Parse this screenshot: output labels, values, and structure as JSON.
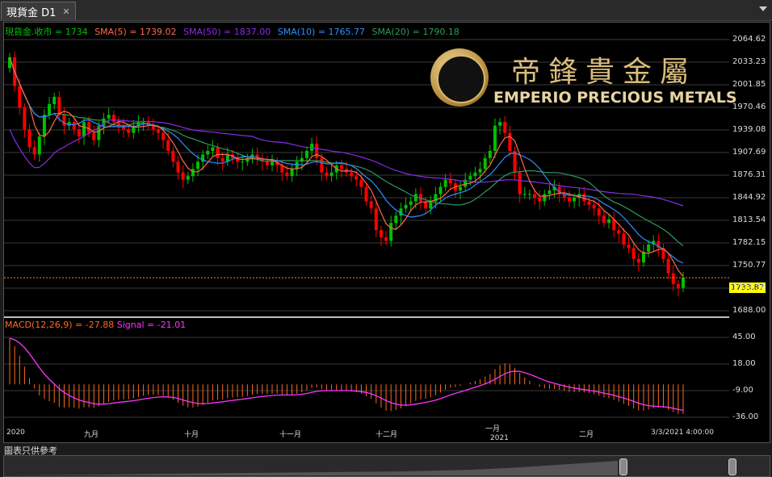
{
  "window": {
    "tab_title": "現貨金 D1",
    "close_label": "✕"
  },
  "legend": {
    "symbol": "現貨金.收市 = 1734",
    "sma5": "SMA(5) = 1739.02",
    "sma50": "SMA(50) = 1837.00",
    "sma10": "SMA(10) = 1765.77",
    "sma20": "SMA(20) = 1790.18"
  },
  "macd_legend": {
    "macd": "MACD(12,26,9) = -27.88",
    "signal": "Signal = -21.01"
  },
  "logo": {
    "chinese": "帝鋒貴金屬",
    "english": "EMPERIO PRECIOUS METALS"
  },
  "price_axis": [
    "2064.62",
    "2033.23",
    "2001.85",
    "1970.46",
    "1939.08",
    "1907.69",
    "1876.31",
    "1844.92",
    "1813.54",
    "1782.15",
    "1750.77",
    "1719.38",
    "1688.00"
  ],
  "current_price": "1733.87",
  "macd_axis": [
    "45.00",
    "18.00",
    "-9.00",
    "-36.00"
  ],
  "x_axis": [
    "2020",
    "九月",
    "十月",
    "十一月",
    "十二月",
    "一月",
    "2021",
    "二月",
    "3/3/2021 4:00:00"
  ],
  "disclaimer": "圖表只供參考",
  "colors": {
    "up": "#00c000",
    "down": "#ff0000",
    "sma5": "#ff6a4a",
    "sma10": "#2b8fff",
    "sma20": "#2e9a5a",
    "sma50": "#8a2be2",
    "macd_line": "#ff33ff",
    "macd_hist": "#ff6a1a"
  },
  "chart_data": {
    "type": "candlestick",
    "timeframe": "D1",
    "ylim": [
      1688.0,
      2064.62
    ],
    "last_close": 1734,
    "sma5": 1739.02,
    "sma10": 1765.77,
    "sma20": 1790.18,
    "sma50": 1837.0,
    "closes": [
      2040,
      2000,
      1970,
      1940,
      1915,
      1905,
      1930,
      1960,
      1975,
      1985,
      1960,
      1945,
      1950,
      1940,
      1930,
      1950,
      1935,
      1925,
      1945,
      1955,
      1960,
      1950,
      1945,
      1940,
      1935,
      1945,
      1950,
      1950,
      1945,
      1940,
      1935,
      1925,
      1910,
      1895,
      1880,
      1870,
      1875,
      1885,
      1895,
      1905,
      1910,
      1915,
      1900,
      1895,
      1905,
      1900,
      1895,
      1895,
      1900,
      1905,
      1900,
      1895,
      1890,
      1895,
      1890,
      1880,
      1875,
      1885,
      1895,
      1900,
      1910,
      1920,
      1900,
      1880,
      1875,
      1880,
      1890,
      1885,
      1880,
      1875,
      1870,
      1860,
      1840,
      1830,
      1800,
      1790,
      1785,
      1810,
      1820,
      1830,
      1835,
      1840,
      1850,
      1840,
      1830,
      1840,
      1850,
      1860,
      1870,
      1865,
      1855,
      1860,
      1870,
      1875,
      1880,
      1885,
      1900,
      1910,
      1945,
      1950,
      1935,
      1910,
      1880,
      1850,
      1850,
      1850,
      1845,
      1840,
      1850,
      1855,
      1860,
      1850,
      1845,
      1840,
      1845,
      1850,
      1840,
      1835,
      1830,
      1820,
      1810,
      1815,
      1800,
      1795,
      1780,
      1775,
      1760,
      1755,
      1770,
      1780,
      1785,
      1775,
      1760,
      1740,
      1725,
      1720,
      1734
    ],
    "macd": {
      "macd": -27.88,
      "signal": -21.01
    },
    "macd_ylim": [
      -36,
      60
    ]
  }
}
